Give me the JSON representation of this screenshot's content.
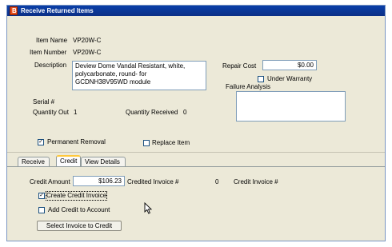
{
  "window": {
    "title": "Receive Returned Items",
    "app_icon": "app-b-icon"
  },
  "item": {
    "name_label": "Item Name",
    "name_value": "VP20W-C",
    "number_label": "Item Number",
    "number_value": "VP20W-C",
    "description_label": "Description",
    "description_lines": [
      "Deview Dome Vandal Resistant, white,",
      "polycarbonate, round- for",
      "GCDNH38V95WD module"
    ],
    "serial_label": "Serial #",
    "qty_out_label": "Quantity Out",
    "qty_out_value": "1",
    "qty_received_label": "Quantity Received",
    "qty_received_value": "0",
    "repair_cost_label": "Repair Cost",
    "repair_cost_value": "$0.00",
    "under_warranty_label": "Under Warranty",
    "under_warranty_checked": false,
    "failure_label": "Failure Analysis",
    "permanent_removal_label": "Permanent Removal",
    "permanent_removal_checked": true,
    "replace_item_label": "Replace Item",
    "replace_item_checked": false
  },
  "tabs": [
    {
      "label": "Receive",
      "active": false
    },
    {
      "label": "Credit",
      "active": true
    },
    {
      "label": "View Details",
      "active": false
    }
  ],
  "credit": {
    "amount_label": "Credit Amount",
    "amount_value": "$106.23",
    "credited_invoice_label": "Credited Invoice #",
    "credited_invoice_value": "0",
    "credit_invoice_label": "Credit Invoice #",
    "create_invoice_label": "Create Credit Invoice",
    "create_invoice_checked": true,
    "add_to_account_label": "Add Credit to Account",
    "add_to_account_checked": false,
    "select_invoice_button": "Select Invoice to Credit"
  },
  "check_glyph": "✓"
}
